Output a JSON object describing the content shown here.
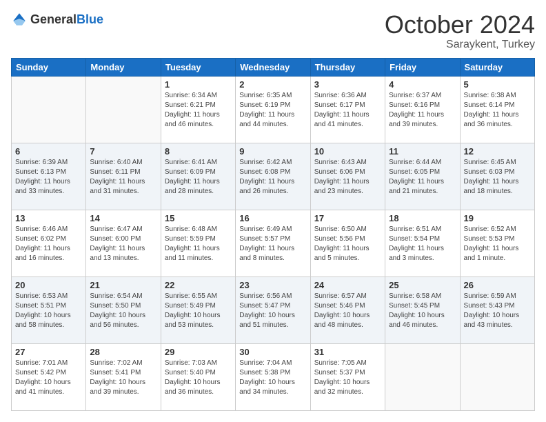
{
  "header": {
    "logo_general": "General",
    "logo_blue": "Blue",
    "month": "October 2024",
    "location": "Saraykent, Turkey"
  },
  "weekdays": [
    "Sunday",
    "Monday",
    "Tuesday",
    "Wednesday",
    "Thursday",
    "Friday",
    "Saturday"
  ],
  "weeks": [
    [
      {
        "day": "",
        "sunrise": "",
        "sunset": "",
        "daylight": "",
        "empty": true
      },
      {
        "day": "",
        "sunrise": "",
        "sunset": "",
        "daylight": "",
        "empty": true
      },
      {
        "day": "1",
        "sunrise": "Sunrise: 6:34 AM",
        "sunset": "Sunset: 6:21 PM",
        "daylight": "Daylight: 11 hours and 46 minutes."
      },
      {
        "day": "2",
        "sunrise": "Sunrise: 6:35 AM",
        "sunset": "Sunset: 6:19 PM",
        "daylight": "Daylight: 11 hours and 44 minutes."
      },
      {
        "day": "3",
        "sunrise": "Sunrise: 6:36 AM",
        "sunset": "Sunset: 6:17 PM",
        "daylight": "Daylight: 11 hours and 41 minutes."
      },
      {
        "day": "4",
        "sunrise": "Sunrise: 6:37 AM",
        "sunset": "Sunset: 6:16 PM",
        "daylight": "Daylight: 11 hours and 39 minutes."
      },
      {
        "day": "5",
        "sunrise": "Sunrise: 6:38 AM",
        "sunset": "Sunset: 6:14 PM",
        "daylight": "Daylight: 11 hours and 36 minutes."
      }
    ],
    [
      {
        "day": "6",
        "sunrise": "Sunrise: 6:39 AM",
        "sunset": "Sunset: 6:13 PM",
        "daylight": "Daylight: 11 hours and 33 minutes."
      },
      {
        "day": "7",
        "sunrise": "Sunrise: 6:40 AM",
        "sunset": "Sunset: 6:11 PM",
        "daylight": "Daylight: 11 hours and 31 minutes."
      },
      {
        "day": "8",
        "sunrise": "Sunrise: 6:41 AM",
        "sunset": "Sunset: 6:09 PM",
        "daylight": "Daylight: 11 hours and 28 minutes."
      },
      {
        "day": "9",
        "sunrise": "Sunrise: 6:42 AM",
        "sunset": "Sunset: 6:08 PM",
        "daylight": "Daylight: 11 hours and 26 minutes."
      },
      {
        "day": "10",
        "sunrise": "Sunrise: 6:43 AM",
        "sunset": "Sunset: 6:06 PM",
        "daylight": "Daylight: 11 hours and 23 minutes."
      },
      {
        "day": "11",
        "sunrise": "Sunrise: 6:44 AM",
        "sunset": "Sunset: 6:05 PM",
        "daylight": "Daylight: 11 hours and 21 minutes."
      },
      {
        "day": "12",
        "sunrise": "Sunrise: 6:45 AM",
        "sunset": "Sunset: 6:03 PM",
        "daylight": "Daylight: 11 hours and 18 minutes."
      }
    ],
    [
      {
        "day": "13",
        "sunrise": "Sunrise: 6:46 AM",
        "sunset": "Sunset: 6:02 PM",
        "daylight": "Daylight: 11 hours and 16 minutes."
      },
      {
        "day": "14",
        "sunrise": "Sunrise: 6:47 AM",
        "sunset": "Sunset: 6:00 PM",
        "daylight": "Daylight: 11 hours and 13 minutes."
      },
      {
        "day": "15",
        "sunrise": "Sunrise: 6:48 AM",
        "sunset": "Sunset: 5:59 PM",
        "daylight": "Daylight: 11 hours and 11 minutes."
      },
      {
        "day": "16",
        "sunrise": "Sunrise: 6:49 AM",
        "sunset": "Sunset: 5:57 PM",
        "daylight": "Daylight: 11 hours and 8 minutes."
      },
      {
        "day": "17",
        "sunrise": "Sunrise: 6:50 AM",
        "sunset": "Sunset: 5:56 PM",
        "daylight": "Daylight: 11 hours and 5 minutes."
      },
      {
        "day": "18",
        "sunrise": "Sunrise: 6:51 AM",
        "sunset": "Sunset: 5:54 PM",
        "daylight": "Daylight: 11 hours and 3 minutes."
      },
      {
        "day": "19",
        "sunrise": "Sunrise: 6:52 AM",
        "sunset": "Sunset: 5:53 PM",
        "daylight": "Daylight: 11 hours and 1 minute."
      }
    ],
    [
      {
        "day": "20",
        "sunrise": "Sunrise: 6:53 AM",
        "sunset": "Sunset: 5:51 PM",
        "daylight": "Daylight: 10 hours and 58 minutes."
      },
      {
        "day": "21",
        "sunrise": "Sunrise: 6:54 AM",
        "sunset": "Sunset: 5:50 PM",
        "daylight": "Daylight: 10 hours and 56 minutes."
      },
      {
        "day": "22",
        "sunrise": "Sunrise: 6:55 AM",
        "sunset": "Sunset: 5:49 PM",
        "daylight": "Daylight: 10 hours and 53 minutes."
      },
      {
        "day": "23",
        "sunrise": "Sunrise: 6:56 AM",
        "sunset": "Sunset: 5:47 PM",
        "daylight": "Daylight: 10 hours and 51 minutes."
      },
      {
        "day": "24",
        "sunrise": "Sunrise: 6:57 AM",
        "sunset": "Sunset: 5:46 PM",
        "daylight": "Daylight: 10 hours and 48 minutes."
      },
      {
        "day": "25",
        "sunrise": "Sunrise: 6:58 AM",
        "sunset": "Sunset: 5:45 PM",
        "daylight": "Daylight: 10 hours and 46 minutes."
      },
      {
        "day": "26",
        "sunrise": "Sunrise: 6:59 AM",
        "sunset": "Sunset: 5:43 PM",
        "daylight": "Daylight: 10 hours and 43 minutes."
      }
    ],
    [
      {
        "day": "27",
        "sunrise": "Sunrise: 7:01 AM",
        "sunset": "Sunset: 5:42 PM",
        "daylight": "Daylight: 10 hours and 41 minutes."
      },
      {
        "day": "28",
        "sunrise": "Sunrise: 7:02 AM",
        "sunset": "Sunset: 5:41 PM",
        "daylight": "Daylight: 10 hours and 39 minutes."
      },
      {
        "day": "29",
        "sunrise": "Sunrise: 7:03 AM",
        "sunset": "Sunset: 5:40 PM",
        "daylight": "Daylight: 10 hours and 36 minutes."
      },
      {
        "day": "30",
        "sunrise": "Sunrise: 7:04 AM",
        "sunset": "Sunset: 5:38 PM",
        "daylight": "Daylight: 10 hours and 34 minutes."
      },
      {
        "day": "31",
        "sunrise": "Sunrise: 7:05 AM",
        "sunset": "Sunset: 5:37 PM",
        "daylight": "Daylight: 10 hours and 32 minutes."
      },
      {
        "day": "",
        "sunrise": "",
        "sunset": "",
        "daylight": "",
        "empty": true
      },
      {
        "day": "",
        "sunrise": "",
        "sunset": "",
        "daylight": "",
        "empty": true
      }
    ]
  ]
}
